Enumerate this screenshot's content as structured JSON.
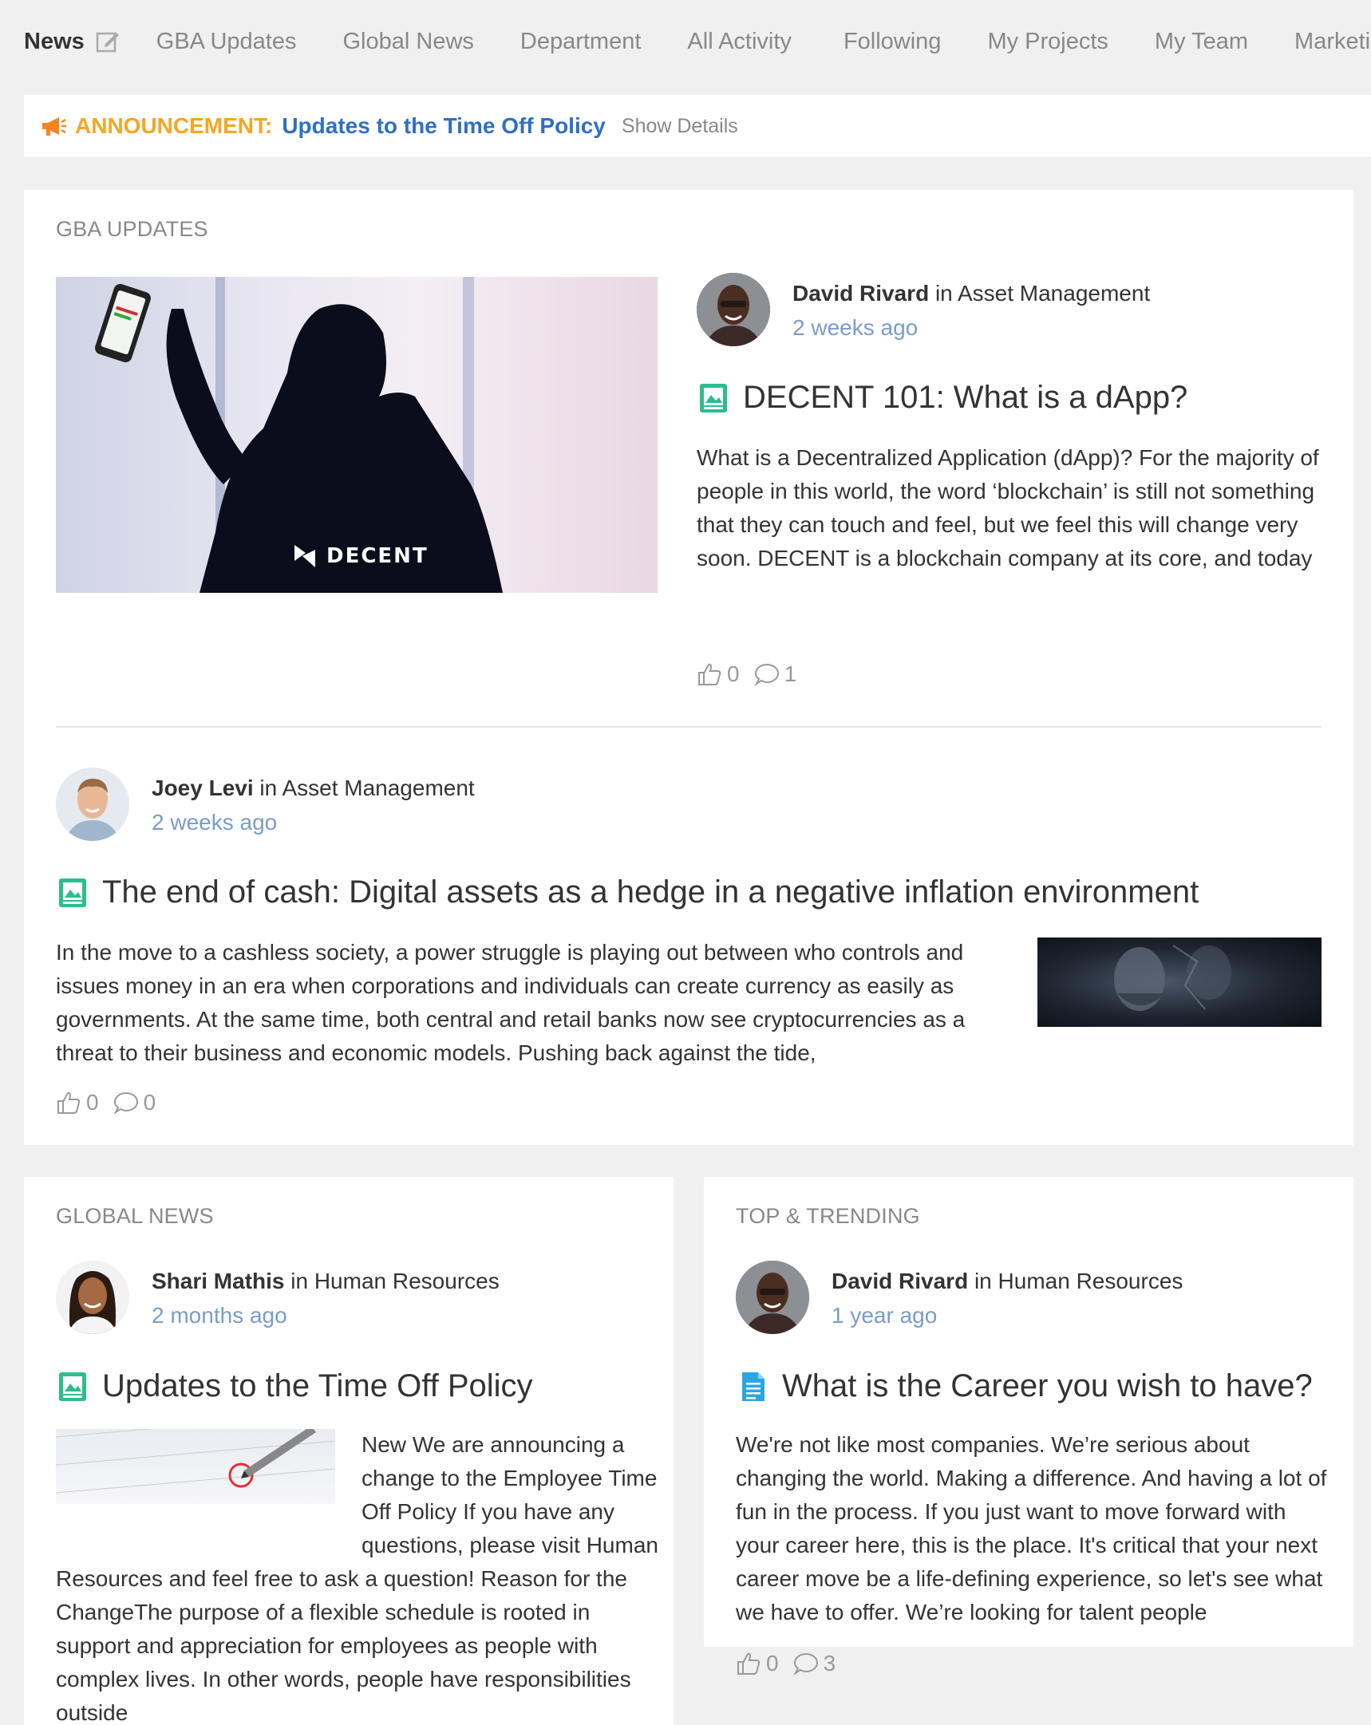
{
  "nav": {
    "news_label": "News",
    "items": [
      "GBA Updates",
      "Global News",
      "Department",
      "All Activity",
      "Following",
      "My Projects",
      "My Team",
      "Marketing"
    ]
  },
  "announcement": {
    "label": "ANNOUNCEMENT:",
    "title": "Updates to the Time Off Policy",
    "details": "Show Details"
  },
  "gba": {
    "section_title": "GBA UPDATES",
    "post1": {
      "author": "David Rivard",
      "in_text": " in Asset Management",
      "time": "2 weeks ago",
      "title": "DECENT 101: What is a dApp?",
      "excerpt": "What is a Decentralized Application (dApp)? For the majority of people in this world, the word ‘blockchain’ is still not something that they can touch and feel, but we feel this will change very soon. DECENT is a blockchain company at its core, and today we wanted to talk about decentralized applications – dApps, for short. One could argue that a",
      "likes": "0",
      "comments": "1",
      "image_brand": "DECENT"
    },
    "post2": {
      "author": "Joey Levi",
      "in_text": " in Asset Management",
      "time": "2 weeks ago",
      "title": "The end of cash: Digital assets as a hedge in a negative inflation environment",
      "excerpt": "In the move to a cashless society, a power struggle is playing out between who controls and issues money in an era when corporations and individuals can create currency as easily as governments. At the same time, both central and retail banks now see cryptocurrencies as a threat to their business and economic models. Pushing back against the tide,",
      "likes": "0",
      "comments": "0"
    }
  },
  "global_news": {
    "section_title": "GLOBAL NEWS",
    "post": {
      "author": "Shari Mathis",
      "in_text": " in Human Resources",
      "time": "2 months ago",
      "title": "Updates to the Time Off Policy",
      "excerpt": "New We are announcing a change to the Employee Time Off Policy   If you have any questions, please visit Human Resources and feel free to ask a question! Reason for the ChangeThe purpose of a flexible schedule is rooted in support and appreciation for employees as people with complex lives. In other words, people have responsibilities outside"
    }
  },
  "trending": {
    "section_title": "TOP & TRENDING",
    "post": {
      "author": "David Rivard",
      "in_text": " in Human Resources",
      "time": "1 year ago",
      "title": "What is the Career you wish to have?",
      "excerpt": "We're not like most companies. We’re serious about changing the world. Making a difference. And having a lot of fun in the process. If you just want to move forward with your career here, this is the place. It's critical that your next career move be a life-defining experience, so let's see what we have to offer. We’re looking for talent people",
      "likes": "0",
      "comments": "3"
    }
  },
  "colors": {
    "accent_blue": "#2f6fc5",
    "announcement_orange": "#f5a623",
    "time_blue": "#7a9cc9",
    "post_icon_green": "#2dbd8f",
    "doc_icon_blue": "#2aa7e0"
  }
}
